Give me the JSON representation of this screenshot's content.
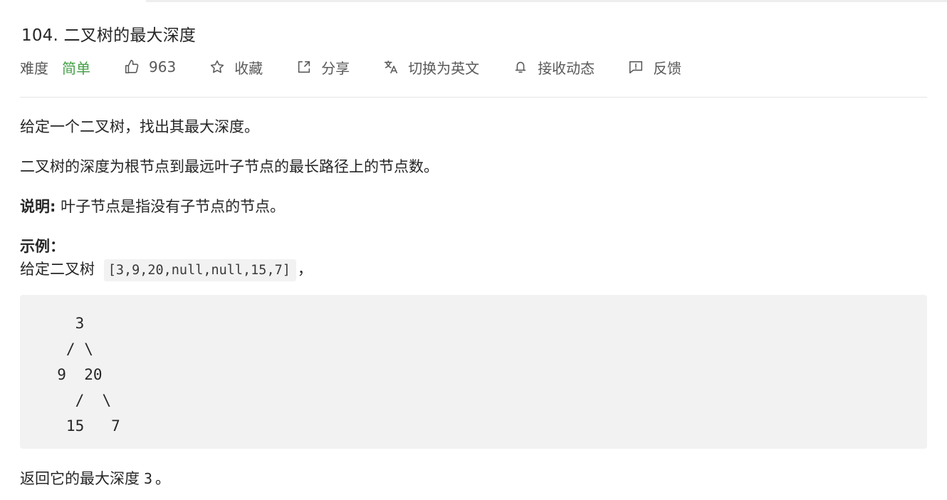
{
  "problem": {
    "title": "104. 二叉树的最大深度",
    "difficulty_label": "难度",
    "difficulty_value": "简单",
    "likes": "963",
    "actions": {
      "favorite": "收藏",
      "share": "分享",
      "switch_lang": "切换为英文",
      "subscribe": "接收动态",
      "feedback": "反馈"
    }
  },
  "content": {
    "p1": "给定一个二叉树，找出其最大深度。",
    "p2": "二叉树的深度为根节点到最远叶子节点的最长路径上的节点数。",
    "note_label": "说明:",
    "note_text": " 叶子节点是指没有子节点的节点。",
    "example_label": "示例：",
    "example_prefix": "给定二叉树 ",
    "example_code": "[3,9,20,null,null,15,7]",
    "example_suffix": "，",
    "tree_diagram": "    3\n   / \\\n  9  20\n    /  \\\n   15   7",
    "return_prefix": "返回它的最大深度",
    "return_value": "3",
    "return_suffix": "。"
  },
  "icons": {
    "like": "thumbs-up-icon",
    "favorite": "star-icon",
    "share": "share-icon",
    "switch_lang": "translate-icon",
    "subscribe": "bell-icon",
    "feedback": "feedback-icon"
  },
  "colors": {
    "difficulty_easy": "#43a047",
    "code_bg": "#f2f2f3",
    "text": "#262626",
    "muted": "#595959"
  }
}
